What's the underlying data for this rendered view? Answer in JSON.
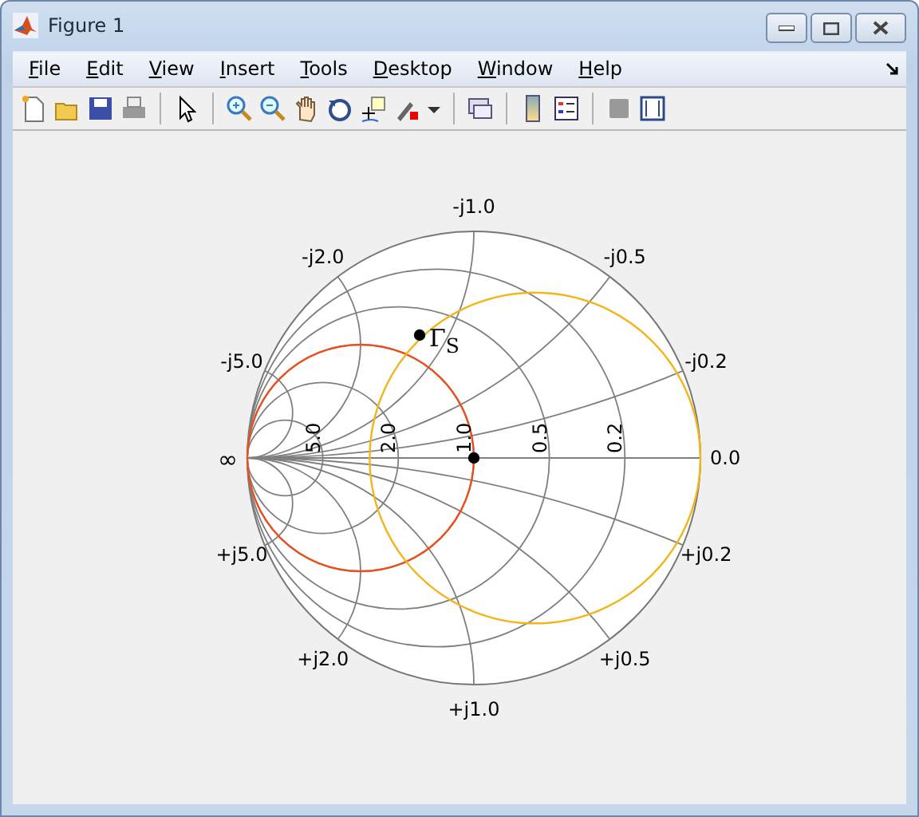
{
  "window": {
    "title": "Figure 1"
  },
  "menu": [
    "File",
    "Edit",
    "View",
    "Insert",
    "Tools",
    "Desktop",
    "Window",
    "Help"
  ],
  "chart": {
    "resistance_labels": [
      "5.0",
      "2.0",
      "1.0",
      "0.5",
      "0.2"
    ],
    "zero_label": "0.0",
    "infinity_label": "∞",
    "reactance_labels_upper": [
      "-j0.2",
      "-j0.5",
      "-j1.0",
      "-j2.0",
      "-j5.0"
    ],
    "reactance_labels_lower": [
      "+j0.2",
      "+j0.5",
      "+j1.0",
      "+j2.0",
      "+j5.0"
    ],
    "circles": [
      {
        "color": "#e8501e"
      },
      {
        "color": "#f2b51b"
      }
    ],
    "point_label": "Γ$_{S}$"
  }
}
